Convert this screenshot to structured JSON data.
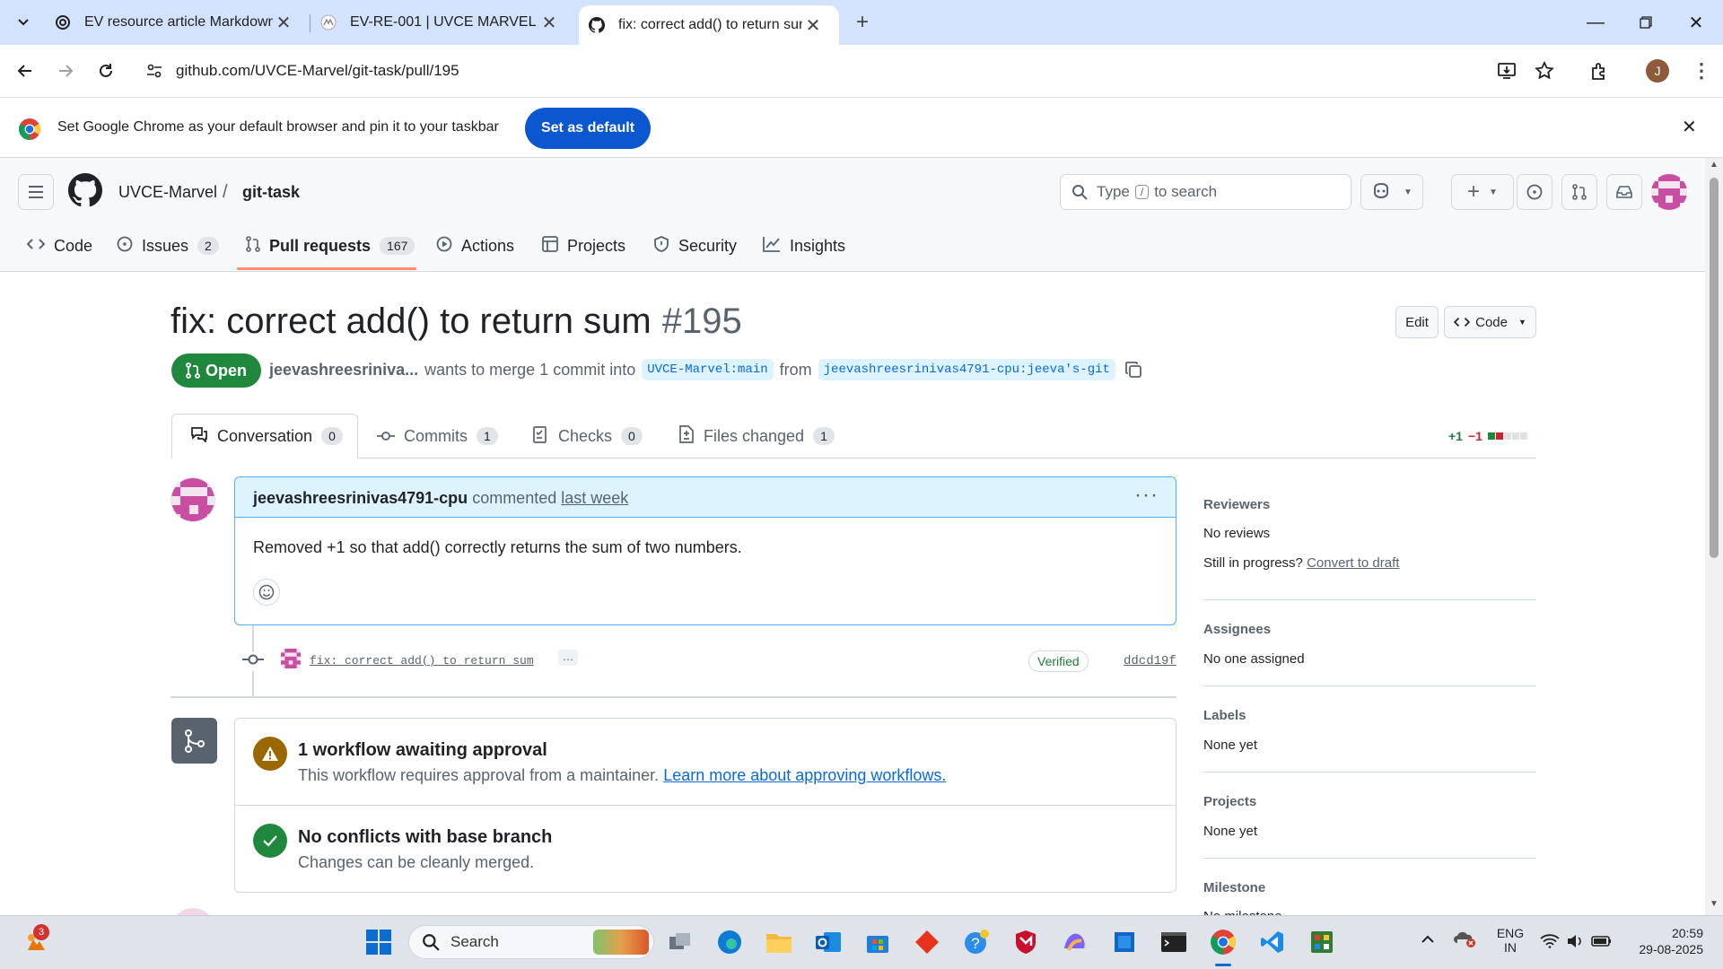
{
  "browser": {
    "tabs": [
      {
        "title": "EV resource article Markdown",
        "icon": "openai-icon"
      },
      {
        "title": "EV-RE-001 | UVCE MARVEL",
        "icon": "marvel-icon"
      },
      {
        "title": "fix: correct add() to return sum",
        "icon": "github-icon",
        "active": true
      }
    ],
    "url": "github.com/UVCE-Marvel/git-task/pull/195",
    "profile_initial": "J",
    "banner_text": "Set Google Chrome as your default browser and pin it to your taskbar",
    "banner_button": "Set as default"
  },
  "github": {
    "owner": "UVCE-Marvel",
    "separator": "/",
    "repo": "git-task",
    "search_placeholder_pre": "Type",
    "search_key": "/",
    "search_placeholder_post": "to search",
    "nav": [
      {
        "label": "Code",
        "icon": "code-icon"
      },
      {
        "label": "Issues",
        "count": "2",
        "icon": "issue-icon"
      },
      {
        "label": "Pull requests",
        "count": "167",
        "icon": "pull-request-icon",
        "selected": true
      },
      {
        "label": "Actions",
        "icon": "play-icon"
      },
      {
        "label": "Projects",
        "icon": "table-icon"
      },
      {
        "label": "Security",
        "icon": "shield-icon"
      },
      {
        "label": "Insights",
        "icon": "graph-icon"
      }
    ]
  },
  "pr": {
    "title": "fix: correct add() to return sum",
    "number": "#195",
    "edit_label": "Edit",
    "code_label": "Code",
    "state": "Open",
    "author_short": "jeevashreesriniva...",
    "merge_text": "wants to merge 1 commit into",
    "base_branch": "UVCE-Marvel:main",
    "from_text": "from",
    "head_branch": "jeevashreesrinivas4791-cpu:jeeva's-git",
    "tabs": [
      {
        "label": "Conversation",
        "count": "0"
      },
      {
        "label": "Commits",
        "count": "1"
      },
      {
        "label": "Files changed",
        "count": "1"
      },
      {
        "label": "Checks",
        "count": "0"
      }
    ],
    "diffstat_add": "+1",
    "diffstat_del": "−1",
    "comment": {
      "author": "jeevashreesrinivas4791-cpu",
      "action": "commented",
      "when": "last week",
      "body": "Removed +1 so that add() correctly returns the sum of two numbers."
    },
    "commit": {
      "message": "fix: correct add() to return sum",
      "more": "…",
      "verified": "Verified",
      "sha": "ddcd19f"
    },
    "merge": {
      "workflow_title": "1 workflow awaiting approval",
      "workflow_sub": "This workflow requires approval from a maintainer.",
      "workflow_link": "Learn more about approving workflows.",
      "conflict_title": "No conflicts with base branch",
      "conflict_sub": "Changes can be cleanly merged."
    },
    "sidebar": {
      "reviewers_h": "Reviewers",
      "reviewers_v": "No reviews",
      "progress_text": "Still in progress?",
      "progress_link": "Convert to draft",
      "assignees_h": "Assignees",
      "assignees_v": "No one assigned",
      "labels_h": "Labels",
      "labels_v": "None yet",
      "projects_h": "Projects",
      "projects_v": "None yet",
      "milestone_h": "Milestone",
      "milestone_v": "No milestone"
    }
  },
  "taskbar": {
    "search": "Search",
    "weather_badge": "3",
    "lang1": "ENG",
    "lang2": "IN",
    "time": "20:59",
    "date": "29-08-2025"
  },
  "colors": {
    "accent": "#0969da",
    "open": "#1f883d",
    "chrome_tabstrip": "#d3e3fd",
    "banner_button": "#0b57d0"
  }
}
